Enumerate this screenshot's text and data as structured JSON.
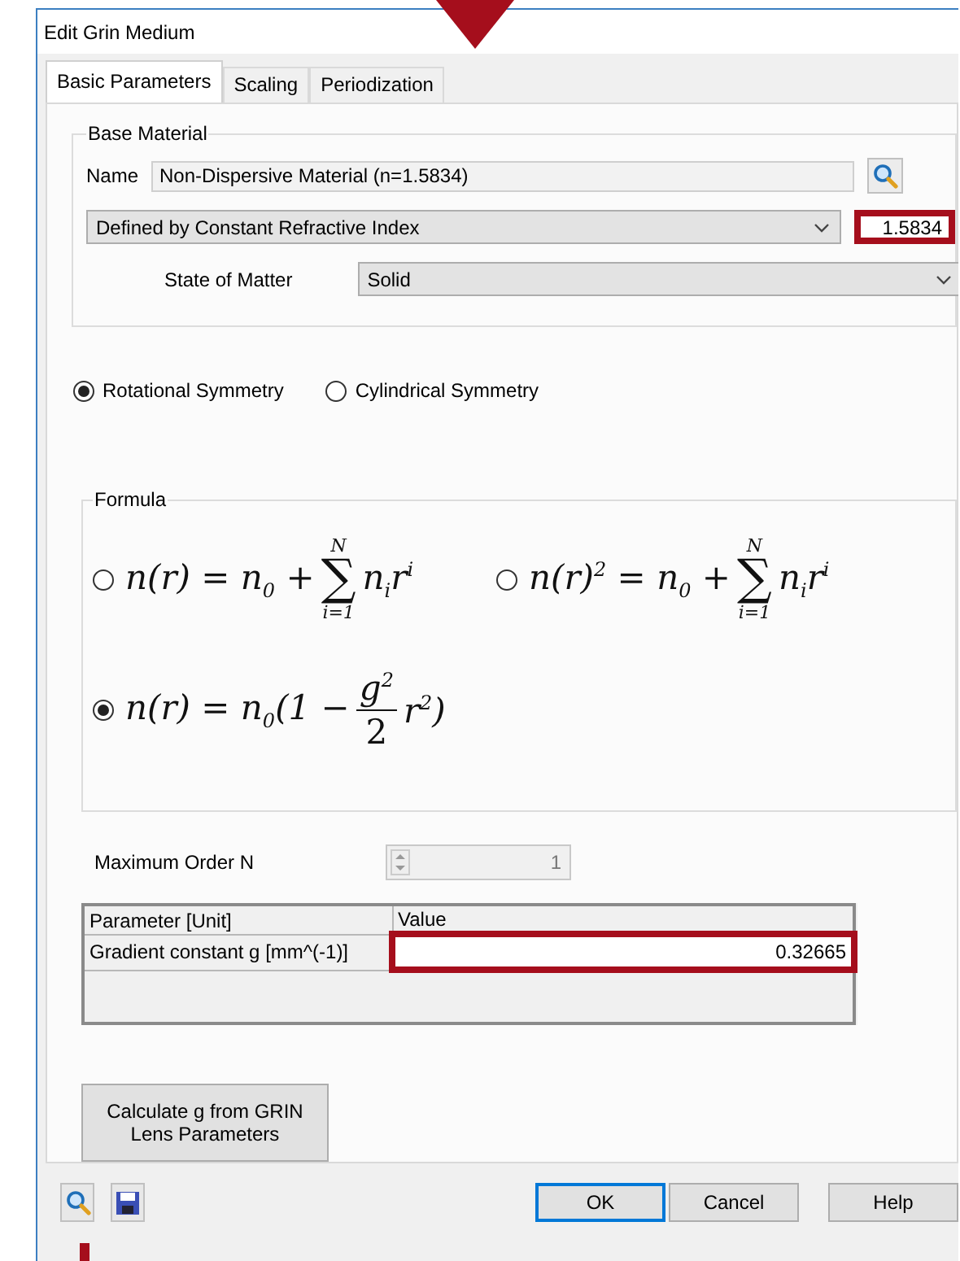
{
  "window": {
    "title": "Edit Grin Medium"
  },
  "tabs": [
    {
      "label": "Basic Parameters",
      "selected": true
    },
    {
      "label": "Scaling",
      "selected": false
    },
    {
      "label": "Periodization",
      "selected": false
    }
  ],
  "base_material": {
    "title": "Base Material",
    "name_label": "Name",
    "name_value": "Non-Dispersive Material (n=1.5834)",
    "definition": "Defined by Constant Refractive Index",
    "refractive_index": {
      "value": "1.5834",
      "highlighted": true
    },
    "state_label": "State of Matter",
    "state_value": "Solid"
  },
  "symmetry": [
    {
      "label": "Rotational Symmetry",
      "selected": true
    },
    {
      "label": "Cylindrical Symmetry",
      "selected": false
    }
  ],
  "formula": {
    "title": "Formula",
    "options": [
      {
        "kind": "sum",
        "selected": false,
        "lhs": "n(r) = n$_{0}$ +",
        "sum_upper": "N",
        "sum_sign": "∑",
        "sum_lower": "i=1",
        "rhs": "n$_{i}$r$^{i}$"
      },
      {
        "kind": "sum",
        "selected": false,
        "lhs": "n(r)$^{2}$ = n$_{0}$ +",
        "sum_upper": "N",
        "sum_sign": "∑",
        "sum_lower": "i=1",
        "rhs": "n$_{i}$r$^{i}$"
      },
      {
        "kind": "fraction",
        "selected": true,
        "lhs": "n(r) = n$_{0}$(1 −",
        "numerator": "g$^{2}$",
        "denominator": "2",
        "rhs": "r$^{2}$)"
      }
    ]
  },
  "max_order": {
    "label": "Maximum Order N",
    "value": "1",
    "disabled": true
  },
  "table": {
    "columns": [
      "Parameter [Unit]",
      "Value"
    ],
    "rows": [
      {
        "parameter": "Gradient constant g [mm^(-1)]",
        "value": "0.32665",
        "highlighted": true
      }
    ]
  },
  "calc_button": "Calculate g from GRIN Lens Parameters",
  "buttons": [
    {
      "label": "OK",
      "default": true
    },
    {
      "label": "Cancel",
      "default": false
    },
    {
      "label": "Help",
      "default": false
    }
  ]
}
